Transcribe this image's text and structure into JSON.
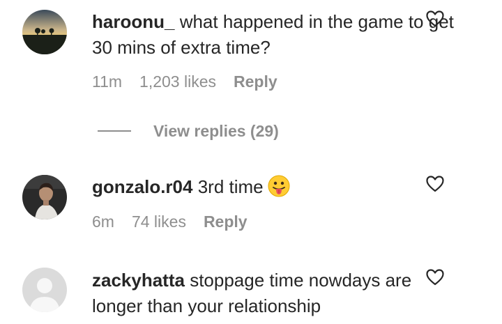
{
  "comments": [
    {
      "username": "haroonu_",
      "text": "what happened in the game to get 30 mins of extra time?",
      "time": "11m",
      "likes": "1,203 likes",
      "reply": "Reply",
      "avatar": "sunset-landscape-avatar"
    },
    {
      "username": "gonzalo.r04",
      "text": "3rd time",
      "emoji": "tongue-out-emoji",
      "time": "6m",
      "likes": "74 likes",
      "reply": "Reply",
      "avatar": "person-photo-avatar"
    },
    {
      "username": "zackyhatta",
      "text": "stoppage time nowdays are longer than your relationship",
      "avatar": "default-avatar"
    }
  ],
  "view_replies": "View replies (29)",
  "colors": {
    "text": "#262626",
    "secondary": "#8e8e8e",
    "emoji_yellow": "#ffcc33"
  }
}
